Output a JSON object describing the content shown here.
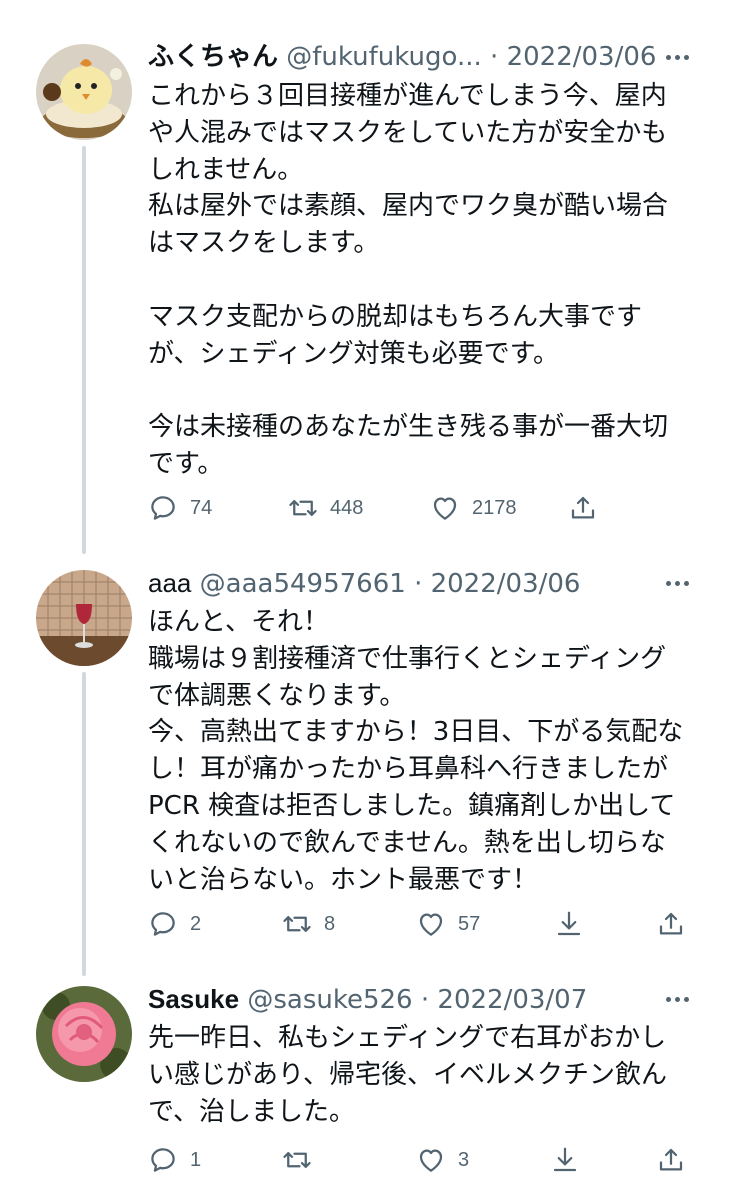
{
  "thread": [
    {
      "name": "ふくちゃん",
      "handle": "@fukufukugo...",
      "separator": "·",
      "date": "2022/03/06",
      "avatar": "chick-cake-avatar",
      "body_lines": [
        "これから３回目接種が進んでしまう今、屋内",
        "や人混みではマスクをしていた方が安全かも",
        "しれません。",
        "私は屋外では素顔、屋内でワク臭が酷い場合",
        "はマスクをします。",
        "",
        "マスク支配からの脱却はもちろん大事です",
        "が、シェディング対策も必要です。",
        "",
        "今は未接種のあなたが生き残る事が一番大切",
        "です。"
      ],
      "replies": "74",
      "retweets": "448",
      "likes": "2178",
      "last_action_icon": "share-icon"
    },
    {
      "name": "aaa",
      "handle": "@aaa54957661",
      "separator": "·",
      "date": "2022/03/06",
      "avatar": "wine-glass-avatar",
      "body_lines": [
        "ほんと、それ！",
        "職場は９割接種済で仕事行くとシェディング",
        "で体調悪くなります。",
        "今、高熱出てますから！3日目、下がる気配な",
        "し！耳が痛かったから耳鼻科へ行きましたが",
        "PCR 検査は拒否しました。鎮痛剤しか出して",
        "くれないので飲んでません。熱を出し切らな",
        "いと治らない。ホント最悪です！"
      ],
      "replies": "2",
      "retweets": "8",
      "likes": "57",
      "extra_action_icon": "download-icon",
      "last_action_icon": "share-icon"
    },
    {
      "name": "Sasuke",
      "handle": "@sasuke526",
      "separator": "·",
      "date": "2022/03/07",
      "avatar": "rose-avatar",
      "body_lines": [
        "先一昨日、私もシェディングで右耳がおかし",
        "い感じがあり、帰宅後、イベルメクチン飲ん",
        "で、治しました。"
      ],
      "replies": "1",
      "retweets": "",
      "likes": "3",
      "extra_action_icon": "download-icon",
      "last_action_icon": "share-icon"
    }
  ],
  "colors": {
    "text": "#0f1419",
    "secondary": "#536471",
    "thread_line": "#cfd9de"
  }
}
